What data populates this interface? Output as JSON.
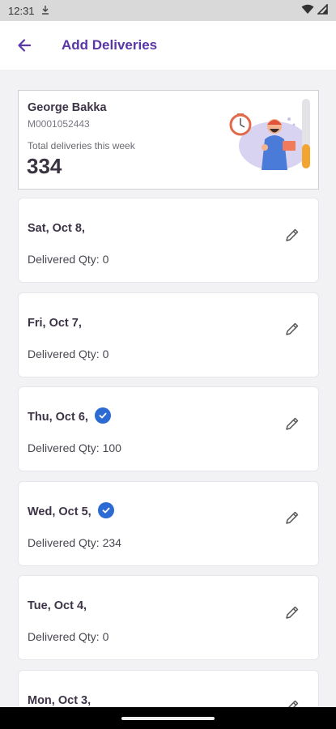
{
  "status_bar": {
    "time": "12:31",
    "icons": [
      "download-icon",
      "wifi-icon",
      "signal-icon"
    ]
  },
  "app_bar": {
    "title": "Add Deliveries",
    "back_icon": "arrow-left-icon",
    "accent_color": "#5a36a6"
  },
  "summary": {
    "name": "George Bakka",
    "id": "M0001052443",
    "label": "Total deliveries this week",
    "total": "334",
    "progress_fraction": 0.35,
    "progress_color": "#f2a531",
    "illustration": "delivery-person-illustration"
  },
  "days": [
    {
      "date": "Sat, Oct 8,",
      "qty": "Delivered Qty: 0",
      "verified": false
    },
    {
      "date": "Fri, Oct 7,",
      "qty": "Delivered Qty: 0",
      "verified": false
    },
    {
      "date": "Thu, Oct 6,",
      "qty": "Delivered Qty: 100",
      "verified": true
    },
    {
      "date": "Wed, Oct 5,",
      "qty": "Delivered Qty: 234",
      "verified": true
    },
    {
      "date": "Tue, Oct 4,",
      "qty": "Delivered Qty: 0",
      "verified": false
    },
    {
      "date": "Mon, Oct 3,",
      "qty": "",
      "verified": false
    }
  ],
  "check_color": "#2d6bd4"
}
